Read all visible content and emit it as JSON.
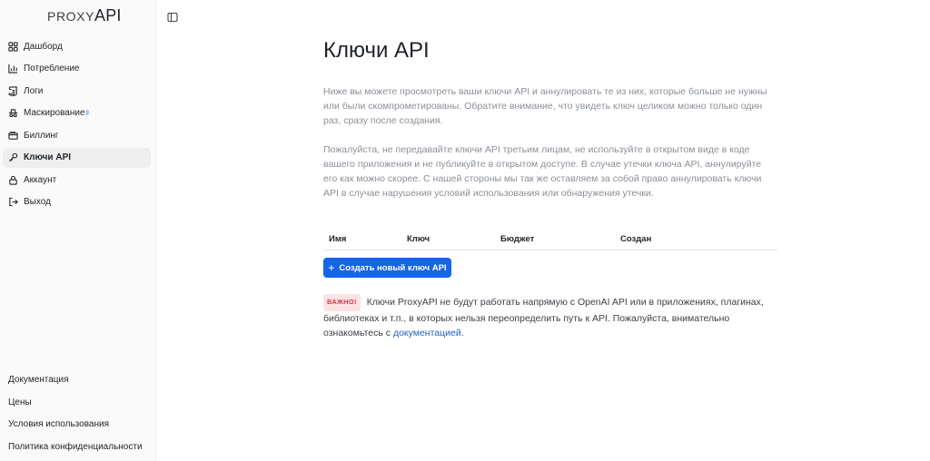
{
  "brand": {
    "light": "PROXY",
    "bold": "API"
  },
  "nav": [
    {
      "label": "Дашборд",
      "icon": "dashboard-icon",
      "active": false
    },
    {
      "label": "Потребление",
      "icon": "bar-chart-icon",
      "active": false
    },
    {
      "label": "Логи",
      "icon": "scroll-icon",
      "active": false
    },
    {
      "label": "Маскирование",
      "icon": "incognito-icon",
      "active": false,
      "badge": "β"
    },
    {
      "label": "Биллинг",
      "icon": "wallet-icon",
      "active": false
    },
    {
      "label": "Ключи API",
      "icon": "key-icon",
      "active": true
    },
    {
      "label": "Аккаунт",
      "icon": "lock-icon",
      "active": false
    },
    {
      "label": "Выход",
      "icon": "logout-icon",
      "active": false
    }
  ],
  "footer_links": [
    "Документация",
    "Цены",
    "Условия использования",
    "Политика конфиденциальности"
  ],
  "page": {
    "title": "Ключи API",
    "paragraph1": "Ниже вы можете просмотреть ваши ключи API и аннулировать те из них, которые больше не нужны или были скомпрометированы. Обратите внимание, что увидеть ключ целиком можно только один раз, сразу после создания.",
    "paragraph2": "Пожалуйста, не передавайте ключи API третьим лицам, не используйте в открытом виде в коде вашего приложения и не публикуйте в открытом доступе. В случае утечки ключа API, аннулируйте его как можно скорее. С нашей стороны мы так же оставляем за собой право аннулировать ключи API в случае нарушения условий использования или обнаружения утечки."
  },
  "table": {
    "columns": [
      "Имя",
      "Ключ",
      "Бюджет",
      "Создан"
    ]
  },
  "create_button": {
    "icon": "+",
    "label": "Создать новый ключ API"
  },
  "important": {
    "badge": "ВАЖНО!",
    "text": " Ключи ProxyAPI не будут работать напрямую с OpenAI API или в приложениях, плагинах, библиотеках и т.п., в которых нельзя переопределить путь к API. Пожалуйста, внимательно ознакомьтесь с ",
    "link": "документацией",
    "end": "."
  },
  "colors": {
    "primary": "#1565e8",
    "badge_bg": "#fde2e4",
    "badge_text": "#d13a4a",
    "link": "#1f62c9",
    "muted_text": "#8b9096"
  }
}
